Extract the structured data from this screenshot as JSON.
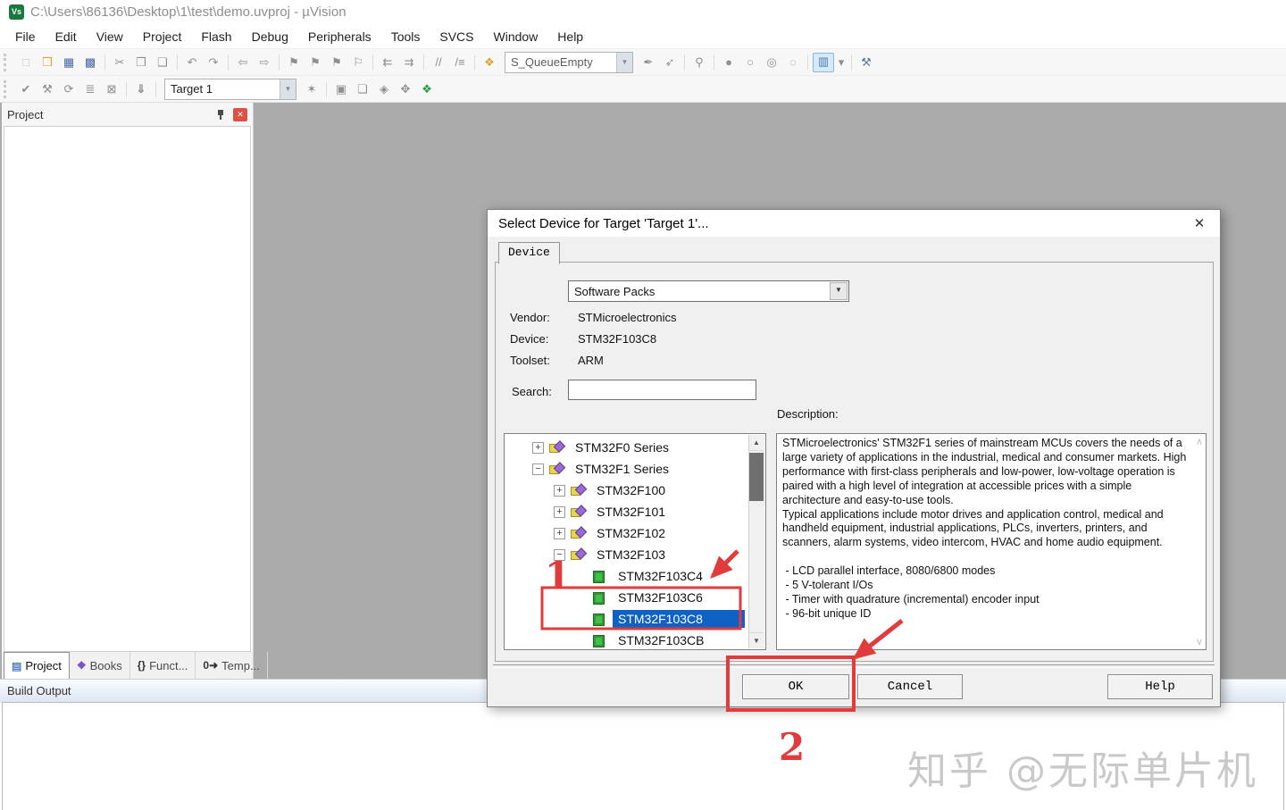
{
  "window": {
    "title": "C:\\Users\\86136\\Desktop\\1\\test\\demo.uvproj - µVision",
    "logo_glyph": "Vs"
  },
  "menu": {
    "items": [
      "File",
      "Edit",
      "View",
      "Project",
      "Flash",
      "Debug",
      "Peripherals",
      "Tools",
      "SVCS",
      "Window",
      "Help"
    ]
  },
  "toolbar1": {
    "combo": {
      "value": "S_QueueEmpty",
      "arrow": "▼"
    },
    "left": [
      {
        "g": "□",
        "name": "new-file-icon",
        "cls": "c-doc"
      },
      {
        "g": "❒",
        "name": "open-folder-icon",
        "cls": "c-folder"
      },
      {
        "g": "▦",
        "name": "save-icon",
        "cls": "c-save"
      },
      {
        "g": "▩",
        "name": "save-all-icon",
        "cls": "c-save"
      },
      {
        "cls": "sep",
        "name": "toolbar-separator",
        "inter": "false"
      },
      {
        "g": "✂",
        "name": "cut-icon"
      },
      {
        "g": "❐",
        "name": "copy-icon"
      },
      {
        "g": "❑",
        "name": "paste-icon"
      },
      {
        "cls": "sep",
        "name": "toolbar-separator",
        "inter": "false"
      },
      {
        "g": "↶",
        "name": "undo-icon"
      },
      {
        "g": "↷",
        "name": "redo-icon"
      },
      {
        "cls": "sep",
        "name": "toolbar-separator",
        "inter": "false"
      },
      {
        "g": "⇦",
        "name": "navigate-back-icon"
      },
      {
        "g": "⇨",
        "name": "navigate-forward-icon"
      },
      {
        "cls": "sep",
        "name": "toolbar-separator",
        "inter": "false"
      },
      {
        "g": "⚑",
        "name": "insert-bookmark-icon"
      },
      {
        "g": "⚑",
        "name": "previous-bookmark-icon"
      },
      {
        "g": "⚑",
        "name": "next-bookmark-icon"
      },
      {
        "g": "⚐",
        "name": "clear-bookmarks-icon"
      },
      {
        "cls": "sep",
        "name": "toolbar-separator",
        "inter": "false"
      },
      {
        "g": "⇇",
        "name": "unindent-icon"
      },
      {
        "g": "⇉",
        "name": "indent-icon"
      },
      {
        "cls": "sep",
        "name": "toolbar-separator",
        "inter": "false"
      },
      {
        "g": "//",
        "name": "comment-selection-icon"
      },
      {
        "g": "/≡",
        "name": "uncomment-selection-icon"
      },
      {
        "cls": "sep",
        "name": "toolbar-separator",
        "inter": "false"
      },
      {
        "g": "❖",
        "name": "configure-flash-icon",
        "cls": "c-folder"
      }
    ],
    "right": [
      {
        "g": "✒",
        "name": "find-in-files-icon"
      },
      {
        "g": "➶",
        "name": "goto-definition-icon"
      },
      {
        "cls": "sep",
        "name": "toolbar-separator",
        "inter": "false"
      },
      {
        "g": "⚲",
        "name": "find-icon"
      },
      {
        "cls": "sep",
        "name": "toolbar-separator",
        "inter": "false"
      },
      {
        "g": "●",
        "name": "insert-breakpoint-icon"
      },
      {
        "g": "○",
        "name": "enable-breakpoint-icon"
      },
      {
        "g": "◎",
        "name": "disable-all-breakpoints-icon"
      },
      {
        "g": "◌",
        "name": "kill-all-breakpoints-icon"
      },
      {
        "cls": "sep",
        "name": "toolbar-separator",
        "inter": "false"
      },
      {
        "g": "▥",
        "name": "project-window-toggle-icon",
        "cls": "active"
      },
      {
        "g": "▾",
        "name": "window-list-dropdown-icon",
        "cls": "narrow"
      },
      {
        "cls": "sep",
        "name": "toolbar-separator",
        "inter": "false"
      },
      {
        "g": "⚒",
        "name": "configuration-wrench-icon",
        "cls": "c-wrench"
      }
    ]
  },
  "toolbar2": {
    "combo": {
      "value": "Target 1",
      "arrow": "▼"
    },
    "left": [
      {
        "g": "✔",
        "name": "translate-file-icon"
      },
      {
        "g": "⚒",
        "name": "build-icon"
      },
      {
        "g": "⟳",
        "name": "rebuild-all-icon"
      },
      {
        "g": "≣",
        "name": "batch-build-icon"
      },
      {
        "g": "⊠",
        "name": "stop-build-icon"
      },
      {
        "cls": "sep",
        "name": "toolbar-separator",
        "inter": "false"
      },
      {
        "g": "⇓",
        "name": "download-icon",
        "cls": "c-load"
      },
      {
        "cls": "sep",
        "name": "toolbar-separator",
        "inter": "false"
      }
    ],
    "right": [
      {
        "g": "✶",
        "name": "options-for-target-icon"
      },
      {
        "cls": "sep",
        "name": "toolbar-separator",
        "inter": "false"
      },
      {
        "g": "▣",
        "name": "edit-components-icon"
      },
      {
        "g": "❏",
        "name": "manage-multiproject-icon"
      },
      {
        "g": "◈",
        "name": "runtime-environment-icon"
      },
      {
        "g": "✥",
        "name": "select-software-packs-icon"
      },
      {
        "g": "❖",
        "name": "pack-installer-icon",
        "cls": "c-green"
      }
    ]
  },
  "project_panel": {
    "title": "Project",
    "close_glyph": "✕",
    "tabs": [
      {
        "icon": "▤",
        "label": "Project",
        "name": "tab-project",
        "cls": "active i-proj"
      },
      {
        "icon": "❖",
        "label": "Books",
        "name": "tab-books",
        "cls": "i-books"
      },
      {
        "icon": "{}",
        "label": "Funct...",
        "name": "tab-functions",
        "cls": "i-funct"
      },
      {
        "icon": "0➜",
        "label": "Temp...",
        "name": "tab-templates",
        "cls": "i-temp"
      }
    ]
  },
  "build_output": {
    "title": "Build Output"
  },
  "watermark": {
    "text": "知乎 @无际单片机",
    "color": "#c9c9c9"
  },
  "dialog": {
    "title": "Select Device for Target 'Target 1'...",
    "close_glyph": "✕",
    "tab_label": "Device",
    "pack_select": {
      "value": "Software Packs",
      "arrow": "▼"
    },
    "fields": [
      {
        "label": "Vendor:",
        "value": "STMicroelectronics"
      },
      {
        "label": "Device:",
        "value": "STM32F103C8"
      },
      {
        "label": "Toolset:",
        "value": "ARM"
      }
    ],
    "search_label": "Search:",
    "search_value": "",
    "description_label": "Description:",
    "description": "STMicroelectronics' STM32F1 series of mainstream MCUs covers the needs of a large variety of applications in the industrial, medical and consumer markets. High performance with first-class peripherals and low-power, low-voltage operation is paired with a high level of integration at accessible prices with a simple architecture and easy-to-use tools.\nTypical applications include motor drives and application control, medical and handheld equipment, industrial applications, PLCs, inverters, printers, and scanners, alarm systems, video intercom, HVAC and home audio equipment.\n\n - LCD parallel interface, 8080/6800 modes\n - 5 V-tolerant I/Os\n - Timer with quadrature (incremental) encoder input\n - 96-bit unique ID",
    "tree": {
      "selection_color": "#0f62c4",
      "scroll_up": "▲",
      "scroll_down": "▼",
      "items": [
        {
          "label": "STM32F0 Series",
          "level": "0",
          "exp": "+",
          "icon": "pack"
        },
        {
          "label": "STM32F1 Series",
          "level": "0",
          "exp": "−",
          "icon": "pack"
        },
        {
          "label": "STM32F100",
          "level": "1",
          "exp": "+",
          "icon": "pack"
        },
        {
          "label": "STM32F101",
          "level": "1",
          "exp": "+",
          "icon": "pack"
        },
        {
          "label": "STM32F102",
          "level": "1",
          "exp": "+",
          "icon": "pack"
        },
        {
          "label": "STM32F103",
          "level": "1",
          "exp": "−",
          "icon": "pack"
        },
        {
          "label": "STM32F103C4",
          "level": "2",
          "exp": "",
          "icon": "chip"
        },
        {
          "label": "STM32F103C6",
          "level": "2",
          "exp": "",
          "icon": "chip"
        },
        {
          "label": "STM32F103C8",
          "level": "2",
          "exp": "",
          "icon": "chip",
          "cls": "selected"
        },
        {
          "label": "STM32F103CB",
          "level": "2",
          "exp": "",
          "icon": "chip"
        }
      ]
    },
    "desc_scroll": {
      "up": "∧",
      "down": "∨"
    },
    "buttons": {
      "ok": "OK",
      "cancel": "Cancel",
      "help": "Help"
    }
  },
  "annotations": {
    "color": "#e23b3b",
    "step1_label": "1",
    "step2_label": "2"
  }
}
